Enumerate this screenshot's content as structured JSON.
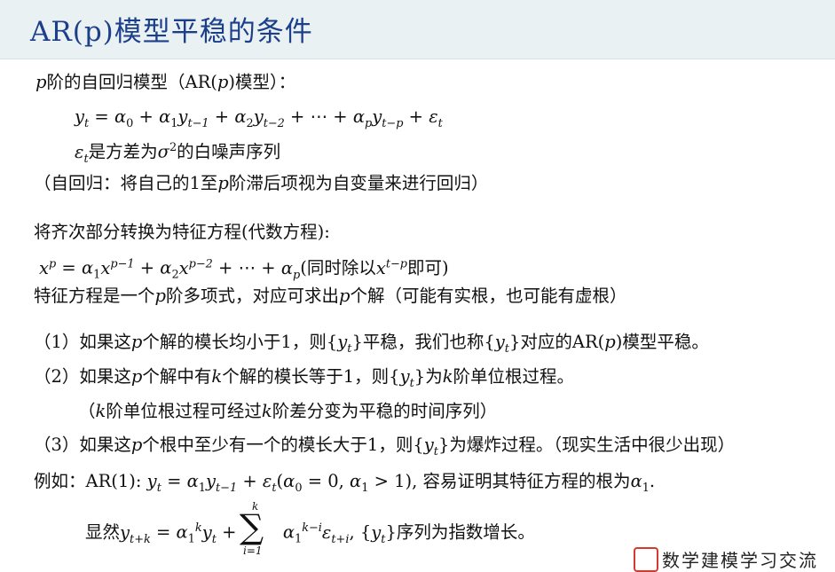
{
  "header": {
    "title": "AR(p)模型平稳的条件"
  },
  "intro": {
    "heading_label": "阶的自回归模型（AR(",
    "heading_tail": ")模型）："
  },
  "eq1_text": "是方差为",
  "eq1_text2": "的白噪声序列",
  "note1": "（自回归：将自己的1至",
  "note1_tail": "阶滞后项视为自变量来进行回归）",
  "char": {
    "line1": "将齐次部分转换为特征方程(代数方程):",
    "line2_tail1": "(同时除以",
    "line2_tail2": "即可)",
    "line3a": "特征方程是一个",
    "line3b": "阶多项式，对应可求出",
    "line3c": "个解（可能有实根，也可能有虚根）"
  },
  "cases": {
    "c1a": "（1）如果这",
    "c1b": "个解的模长均小于1，则{",
    "c1c": "}平稳，我们也称{",
    "c1d": "}对应的AR(",
    "c1e": ")模型平稳。",
    "c2a": "（2）如果这",
    "c2b": "个解中有",
    "c2c": "个解的模长等于1，则{",
    "c2d": "}为",
    "c2e": "阶单位根过程。",
    "c2note_a": "（",
    "c2note_b": "阶单位根过程可经过",
    "c2note_c": "阶差分变为平稳的时间序列）",
    "c3a": "（3）如果这",
    "c3b": "个根中至少有一个的模长大于1，则{",
    "c3c": "}为爆炸过程。（现实生活中很少出现）"
  },
  "example": {
    "a": "例如：AR(1):",
    "b": ", 容易证明其特征方程的根为",
    "sum_prefix": "显然",
    "sum_suffix": "序列为指数增长。"
  },
  "watermark": {
    "text": "数学建模学习交流"
  }
}
